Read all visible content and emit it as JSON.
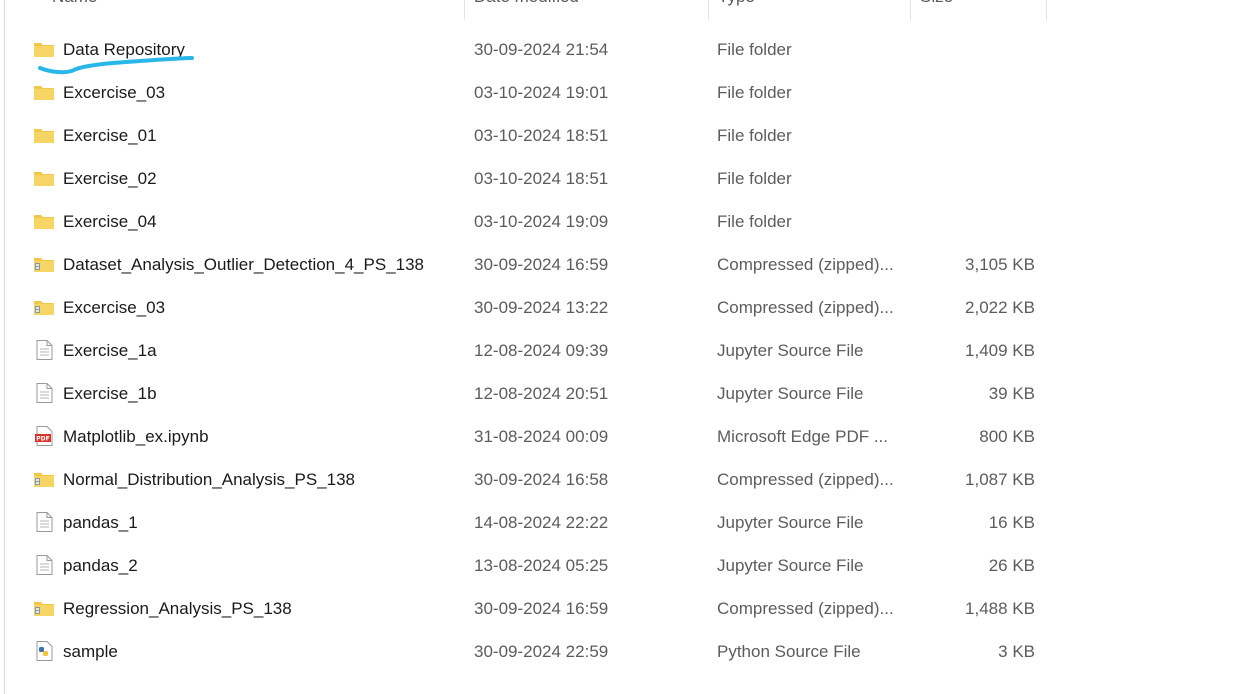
{
  "columns": {
    "name": "Name",
    "date": "Date modified",
    "type": "Type",
    "size": "Size"
  },
  "files": [
    {
      "name": "Data Repository",
      "date": "30-09-2024 21:54",
      "type": "File folder",
      "size": "",
      "icon": "folder-icon"
    },
    {
      "name": "Excercise_03",
      "date": "03-10-2024 19:01",
      "type": "File folder",
      "size": "",
      "icon": "folder-icon"
    },
    {
      "name": "Exercise_01",
      "date": "03-10-2024 18:51",
      "type": "File folder",
      "size": "",
      "icon": "folder-icon"
    },
    {
      "name": "Exercise_02",
      "date": "03-10-2024 18:51",
      "type": "File folder",
      "size": "",
      "icon": "folder-icon"
    },
    {
      "name": "Exercise_04",
      "date": "03-10-2024 19:09",
      "type": "File folder",
      "size": "",
      "icon": "folder-icon"
    },
    {
      "name": "Dataset_Analysis_Outlier_Detection_4_PS_138",
      "date": "30-09-2024 16:59",
      "type": "Compressed (zipped)...",
      "size": "3,105 KB",
      "icon": "zip-folder-icon"
    },
    {
      "name": "Excercise_03",
      "date": "30-09-2024 13:22",
      "type": "Compressed (zipped)...",
      "size": "2,022 KB",
      "icon": "zip-folder-icon"
    },
    {
      "name": "Exercise_1a",
      "date": "12-08-2024 09:39",
      "type": "Jupyter Source File",
      "size": "1,409 KB",
      "icon": "document-icon"
    },
    {
      "name": "Exercise_1b",
      "date": "12-08-2024 20:51",
      "type": "Jupyter Source File",
      "size": "39 KB",
      "icon": "document-icon"
    },
    {
      "name": "Matplotlib_ex.ipynb",
      "date": "31-08-2024 00:09",
      "type": "Microsoft Edge PDF ...",
      "size": "800 KB",
      "icon": "pdf-icon"
    },
    {
      "name": "Normal_Distribution_Analysis_PS_138",
      "date": "30-09-2024 16:58",
      "type": "Compressed (zipped)...",
      "size": "1,087 KB",
      "icon": "zip-folder-icon"
    },
    {
      "name": "pandas_1",
      "date": "14-08-2024 22:22",
      "type": "Jupyter Source File",
      "size": "16 KB",
      "icon": "document-icon"
    },
    {
      "name": "pandas_2",
      "date": "13-08-2024 05:25",
      "type": "Jupyter Source File",
      "size": "26 KB",
      "icon": "document-icon"
    },
    {
      "name": "Regression_Analysis_PS_138",
      "date": "30-09-2024 16:59",
      "type": "Compressed (zipped)...",
      "size": "1,488 KB",
      "icon": "zip-folder-icon"
    },
    {
      "name": "sample",
      "date": "30-09-2024 22:59",
      "type": "Python Source File",
      "size": "3 KB",
      "icon": "python-file-icon"
    }
  ],
  "colors": {
    "folder": "#f2c84b",
    "annotation": "#29b6e8",
    "pdf": "#d9342b"
  }
}
